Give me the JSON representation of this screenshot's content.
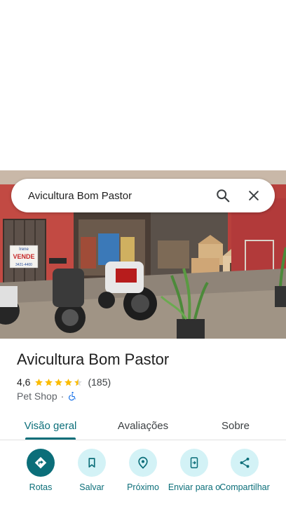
{
  "search": {
    "query": "Avicultura Bom Pastor",
    "search_icon": "search-icon",
    "close_icon": "close-icon"
  },
  "photo": {
    "sign_line1": "Irene",
    "sign_line2": "VENDE",
    "sign_line3": "3421-4400"
  },
  "place": {
    "name": "Avicultura Bom Pastor",
    "rating": "4,6",
    "stars_filled": 4.5,
    "reviews": "(185)",
    "category": "Pet Shop",
    "separator": "·",
    "accessibility_icon": "wheelchair-icon"
  },
  "tabs": [
    {
      "label": "Visão geral",
      "active": true
    },
    {
      "label": "Avaliações",
      "active": false
    },
    {
      "label": "Sobre",
      "active": false
    }
  ],
  "actions": [
    {
      "label": "Rotas",
      "icon": "directions-icon"
    },
    {
      "label": "Salvar",
      "icon": "bookmark-icon"
    },
    {
      "label": "Próximo",
      "icon": "nearby-icon"
    },
    {
      "label": "Enviar para o",
      "icon": "send-to-phone-icon"
    },
    {
      "label": "Compartilhar",
      "icon": "share-icon"
    }
  ],
  "colors": {
    "accent": "#0b6e79",
    "action_bg": "#d3f2f6",
    "star": "#fbbc04"
  }
}
